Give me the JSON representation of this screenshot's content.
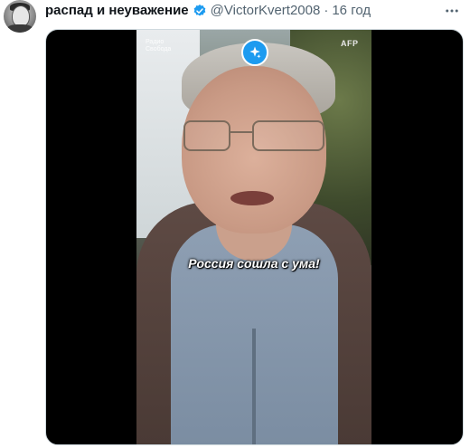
{
  "tweet": {
    "display_name": "распад и неуважение",
    "handle": "@VictorKvert2008",
    "separator": "·",
    "time": "16 год",
    "verified_icon": "verified-badge-icon",
    "more_icon": "more-options-icon"
  },
  "video": {
    "caption": "Россия сошла с ума!",
    "watermark_left_line1": "Радио",
    "watermark_left_line2": "Свобода",
    "watermark_right": "AFP",
    "grok_icon": "sparkle-icon"
  },
  "colors": {
    "verified": "#1d9bf0",
    "text_primary": "#0f1419",
    "text_secondary": "#536471",
    "grok_button": "#1d9bf0"
  }
}
